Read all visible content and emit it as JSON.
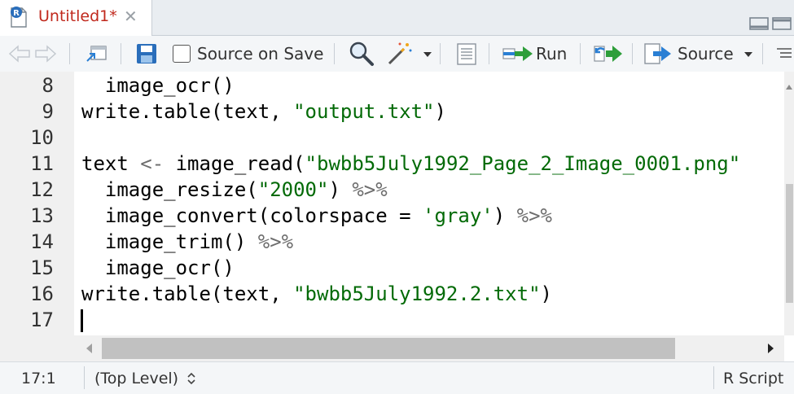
{
  "tab": {
    "title": "Untitled1*",
    "close_glyph": "✕",
    "icon": "r-script-file-icon"
  },
  "toolbar": {
    "source_on_save_label": "Source on Save",
    "run_label": "Run",
    "source_label": "Source",
    "icons": [
      "back-arrow-icon",
      "forward-arrow-icon",
      "show-in-window-icon",
      "save-icon",
      "search-icon",
      "magic-wand-icon",
      "compile-report-icon",
      "run-icon",
      "rerun-icon",
      "source-icon",
      "outline-icon"
    ]
  },
  "editor": {
    "lines": [
      {
        "n": "8",
        "parts": [
          {
            "t": "  image_ocr()",
            "c": ""
          }
        ]
      },
      {
        "n": "9",
        "parts": [
          {
            "t": "write.table(text, ",
            "c": ""
          },
          {
            "t": "\"output.txt\"",
            "c": "str"
          },
          {
            "t": ")",
            "c": ""
          }
        ]
      },
      {
        "n": "10",
        "parts": []
      },
      {
        "n": "11",
        "parts": [
          {
            "t": "text ",
            "c": ""
          },
          {
            "t": "<-",
            "c": "op"
          },
          {
            "t": " image_read(",
            "c": ""
          },
          {
            "t": "\"bwbb5July1992_Page_2_Image_0001.png\"",
            "c": "str"
          }
        ]
      },
      {
        "n": "12",
        "parts": [
          {
            "t": "  image_resize(",
            "c": ""
          },
          {
            "t": "\"2000\"",
            "c": "str"
          },
          {
            "t": ") ",
            "c": ""
          },
          {
            "t": "%>%",
            "c": "op"
          }
        ]
      },
      {
        "n": "13",
        "parts": [
          {
            "t": "  image_convert(colorspace = ",
            "c": ""
          },
          {
            "t": "'gray'",
            "c": "str"
          },
          {
            "t": ") ",
            "c": ""
          },
          {
            "t": "%>%",
            "c": "op"
          }
        ]
      },
      {
        "n": "14",
        "parts": [
          {
            "t": "  image_trim() ",
            "c": ""
          },
          {
            "t": "%>%",
            "c": "op"
          }
        ]
      },
      {
        "n": "15",
        "parts": [
          {
            "t": "  image_ocr()",
            "c": ""
          }
        ]
      },
      {
        "n": "16",
        "parts": [
          {
            "t": "write.table(text, ",
            "c": ""
          },
          {
            "t": "\"bwbb5July1992.2.txt\"",
            "c": "str"
          },
          {
            "t": ")",
            "c": ""
          }
        ]
      },
      {
        "n": "17",
        "parts": []
      }
    ]
  },
  "status": {
    "position": "17:1",
    "scope": "(Top Level)",
    "file_type": "R Script"
  },
  "colors": {
    "tab_title": "#c0281c",
    "string": "#036a07",
    "operator": "#6d6d6d",
    "run_arrow": "#2e9e3a",
    "accent_blue": "#2a7fd4"
  }
}
